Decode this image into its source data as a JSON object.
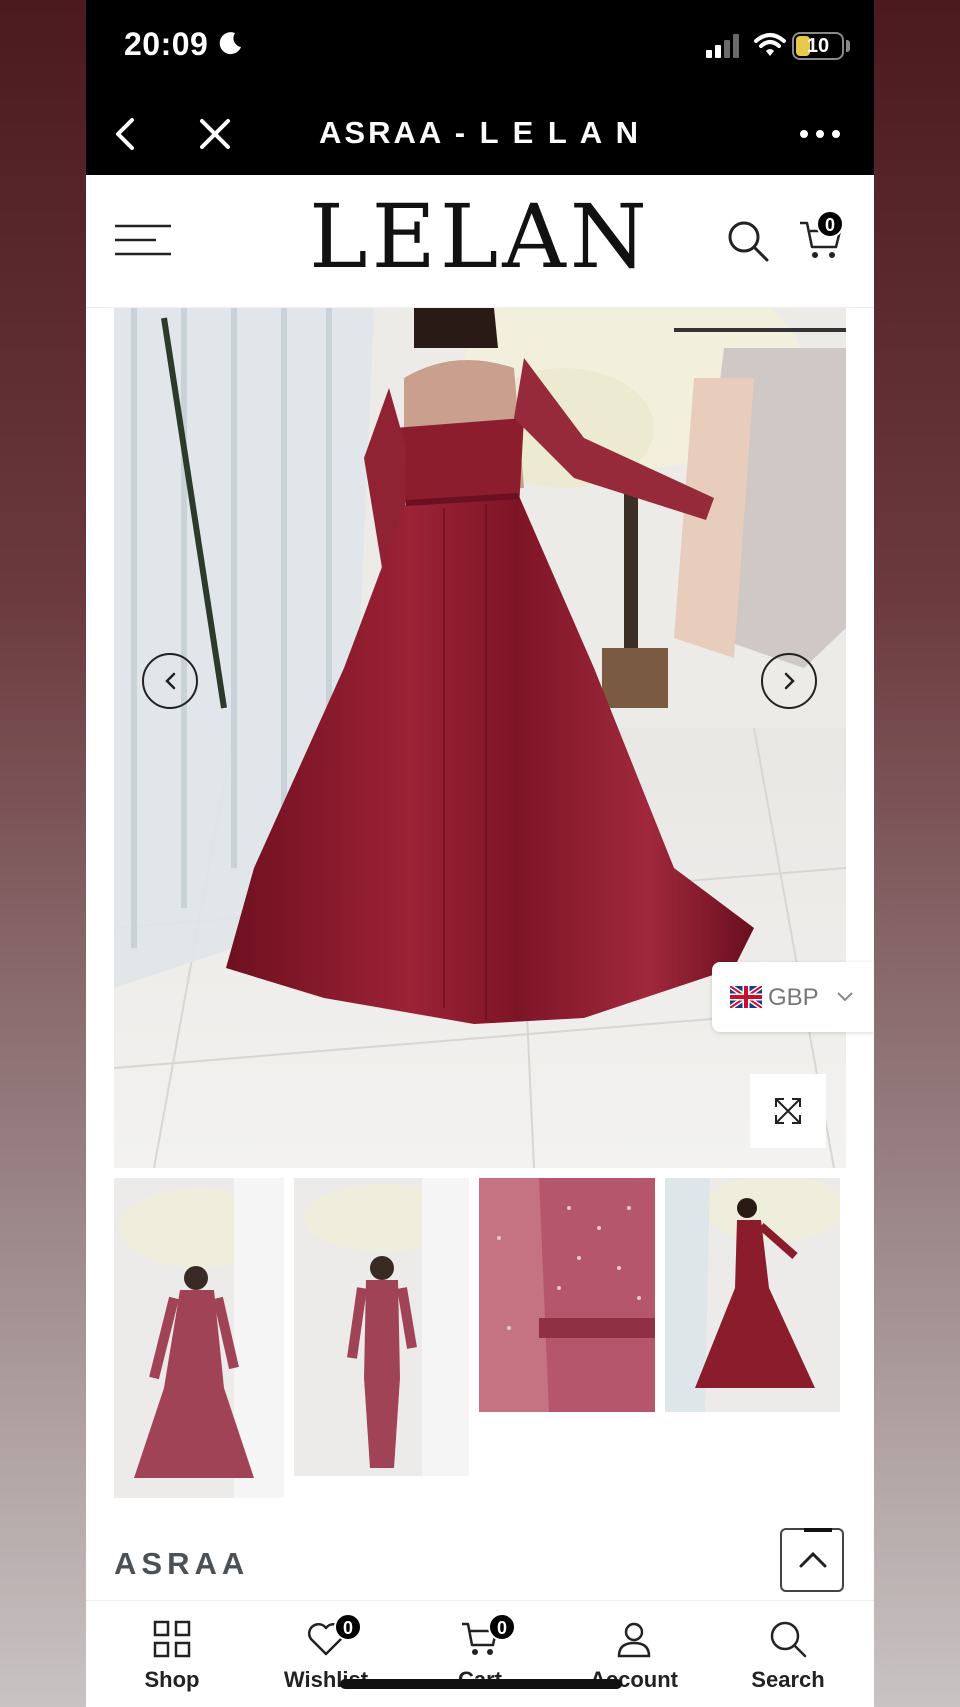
{
  "status_bar": {
    "time": "20:09",
    "battery": "10",
    "icons": [
      "moon-icon",
      "signal-icon",
      "wifi-icon",
      "battery-icon"
    ]
  },
  "browser": {
    "title": "ASRAA - L E L A N",
    "back_icon": "chevron-left-icon",
    "close_icon": "close-icon",
    "more_icon": "more-icon"
  },
  "site_header": {
    "logo": "LELAN",
    "cart_count": "0",
    "icons": [
      "menu-icon",
      "search-icon",
      "cart-icon"
    ]
  },
  "gallery": {
    "main_image": "burgundy satin gown with sequined long-sleeve bodice, back view",
    "currency": "GBP",
    "thumbnails": [
      "front view full gown with overskirt",
      "front view fitted gown",
      "bodice sequin close-up",
      "back view full gown"
    ]
  },
  "product": {
    "title": "ASRAA"
  },
  "bottom_nav": {
    "items": [
      {
        "label": "Shop",
        "icon": "grid-icon"
      },
      {
        "label": "Wishlist",
        "icon": "heart-icon",
        "badge": "0"
      },
      {
        "label": "Cart",
        "icon": "cart-icon",
        "badge": "0"
      },
      {
        "label": "Account",
        "icon": "user-icon"
      },
      {
        "label": "Search",
        "icon": "search-icon"
      }
    ]
  },
  "colors": {
    "dress": "#8a1c2c",
    "header_bg": "#000000",
    "text_dark": "#222222",
    "title_gray": "#4b5257"
  }
}
